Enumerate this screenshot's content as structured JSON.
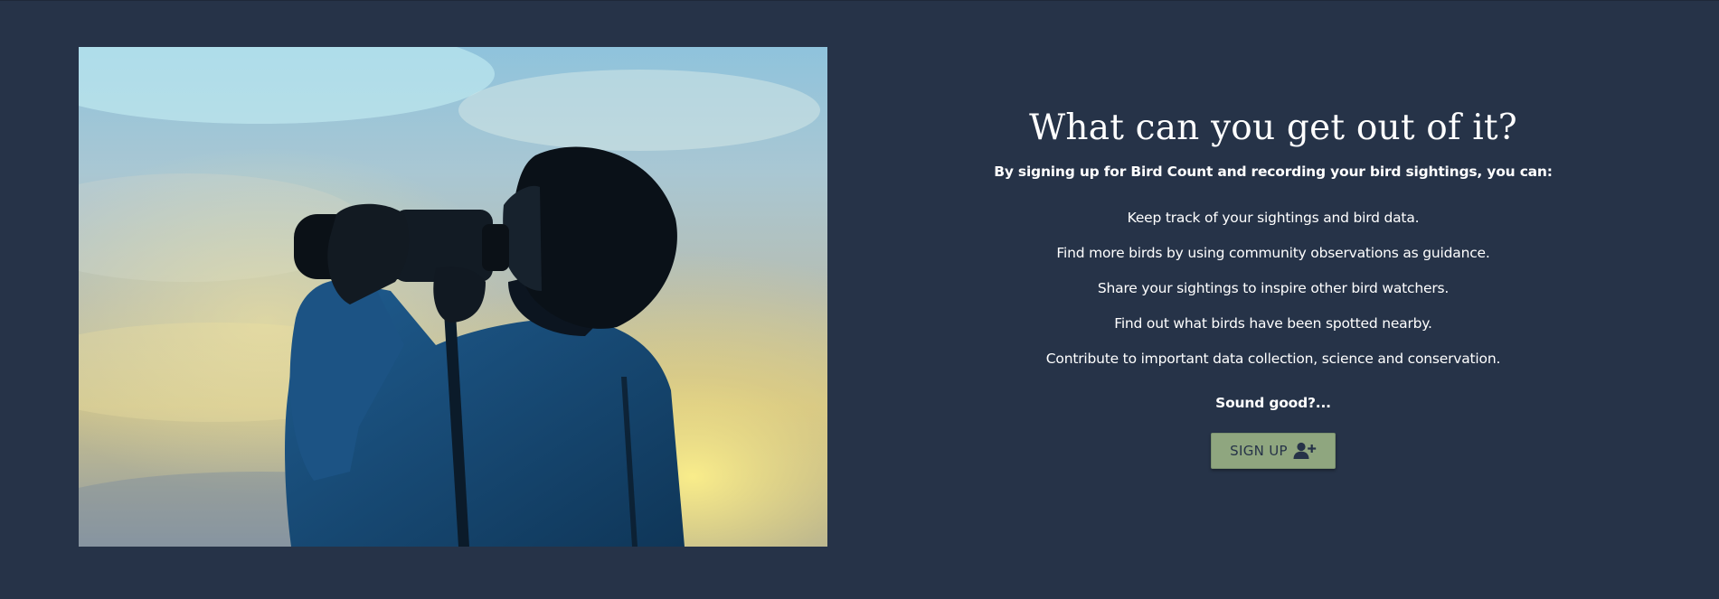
{
  "hero_image": {
    "subject": "person-with-binoculars-silhouette"
  },
  "section": {
    "title": "What can you get out of it?",
    "intro": "By signing up for Bird Count and recording your bird sightings, you can:",
    "benefits": [
      "Keep track of your sightings and bird data.",
      "Find more birds by using community observations as guidance.",
      "Share your sightings to inspire other bird watchers.",
      "Find out what birds have been spotted nearby.",
      "Contribute to important data collection, science and conservation."
    ],
    "prompt": "Sound good?...",
    "signup_button": {
      "label": "SIGN UP",
      "icon": "user-plus-icon"
    }
  },
  "colors": {
    "background": "#263348",
    "button": "#8fa67f",
    "text": "#ffffff"
  }
}
